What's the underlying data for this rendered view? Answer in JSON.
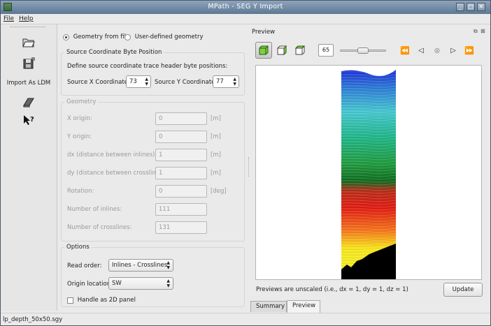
{
  "window": {
    "title": "MPath - SEG Y Import"
  },
  "menubar": {
    "file": "File",
    "help": "Help"
  },
  "toolbar": {
    "import_label": "Import As LDM"
  },
  "geometry_mode": {
    "from_file": "Geometry from file",
    "user_defined": "User-defined geometry",
    "selected": "from_file"
  },
  "source_coord": {
    "title": "Source Coordinate Byte Position",
    "description": "Define source coordinate trace header byte positions:",
    "x_label": "Source X Coordinate:",
    "x_value": "73",
    "y_label": "Source Y Coordinate:",
    "y_value": "77"
  },
  "geometry": {
    "title": "Geometry",
    "rows": [
      {
        "label": "X origin:",
        "value": "0",
        "unit": "[m]"
      },
      {
        "label": "Y origin:",
        "value": "0",
        "unit": "[m]"
      },
      {
        "label": "dx (distance between inlines):",
        "value": "1",
        "unit": "[m]"
      },
      {
        "label": "dy (distance between crosslines):",
        "value": "1",
        "unit": "[m]"
      },
      {
        "label": "Rotation:",
        "value": "0",
        "unit": "[deg]"
      },
      {
        "label": "Number of inlines:",
        "value": "111",
        "unit": ""
      },
      {
        "label": "Number of crosslines:",
        "value": "131",
        "unit": ""
      }
    ]
  },
  "options": {
    "title": "Options",
    "read_order_label": "Read order:",
    "read_order_value": "Inlines - Crosslines",
    "origin_label": "Origin location:",
    "origin_value": "SW",
    "handle_2d_label": "Handle as 2D panel"
  },
  "preview": {
    "title": "Preview",
    "slice_value": "65",
    "slider_fraction": 0.5,
    "note": "Previews are unscaled (i.e., dx = 1, dy = 1, dz = 1)",
    "update_label": "Update",
    "tabs": {
      "summary": "Summary",
      "preview": "Preview"
    }
  },
  "status": {
    "filename": "lp_depth_50x50.sgy"
  }
}
